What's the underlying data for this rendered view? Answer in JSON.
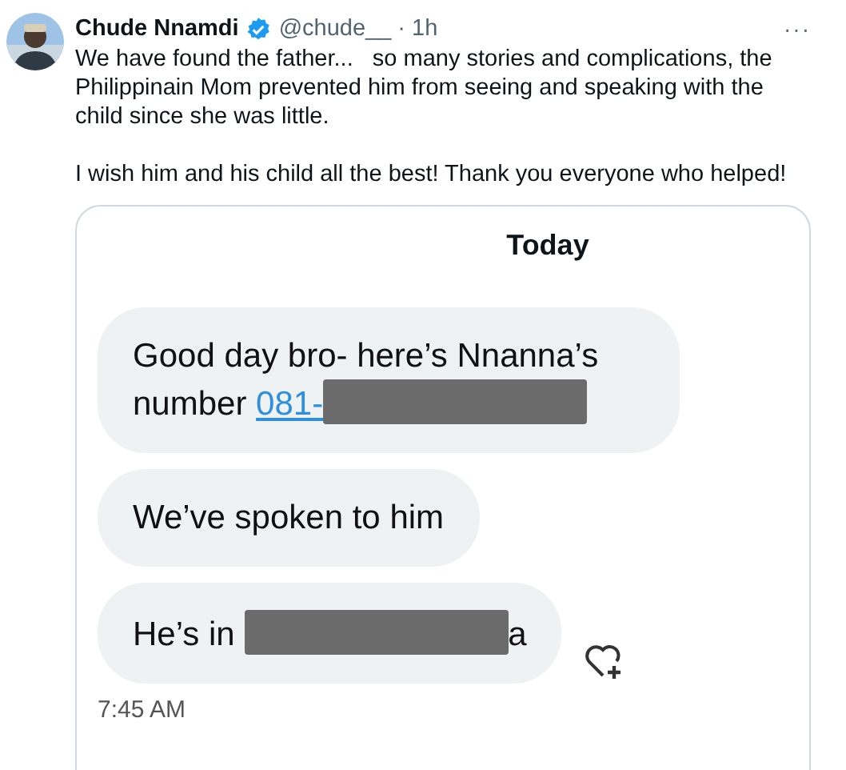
{
  "tweet": {
    "author": {
      "name": "Chude Nnamdi",
      "verified": true,
      "handle": "@chude__",
      "time": "· 1h"
    },
    "more": "···",
    "paragraphs": [
      "We have found the father...   so many stories and complications, the Philippinain Mom prevented him from seeing and speaking with the child since she was little.",
      "I wish him and his child all the best! Thank you everyone who helped!"
    ],
    "attachment": {
      "day": "Today",
      "messages": [
        {
          "parts": [
            {
              "kind": "text",
              "text": "Good day bro- here’s Nnanna’s number "
            },
            {
              "kind": "link",
              "text": "081-"
            },
            {
              "kind": "redacted"
            }
          ]
        },
        {
          "parts": [
            {
              "kind": "text",
              "text": "We’ve spoken to him"
            }
          ]
        },
        {
          "parts": [
            {
              "kind": "text",
              "text": "He’s in "
            },
            {
              "kind": "redacted"
            },
            {
              "kind": "text",
              "text": "a"
            }
          ],
          "reaction_button": true
        }
      ],
      "time": "7:45 AM"
    }
  }
}
